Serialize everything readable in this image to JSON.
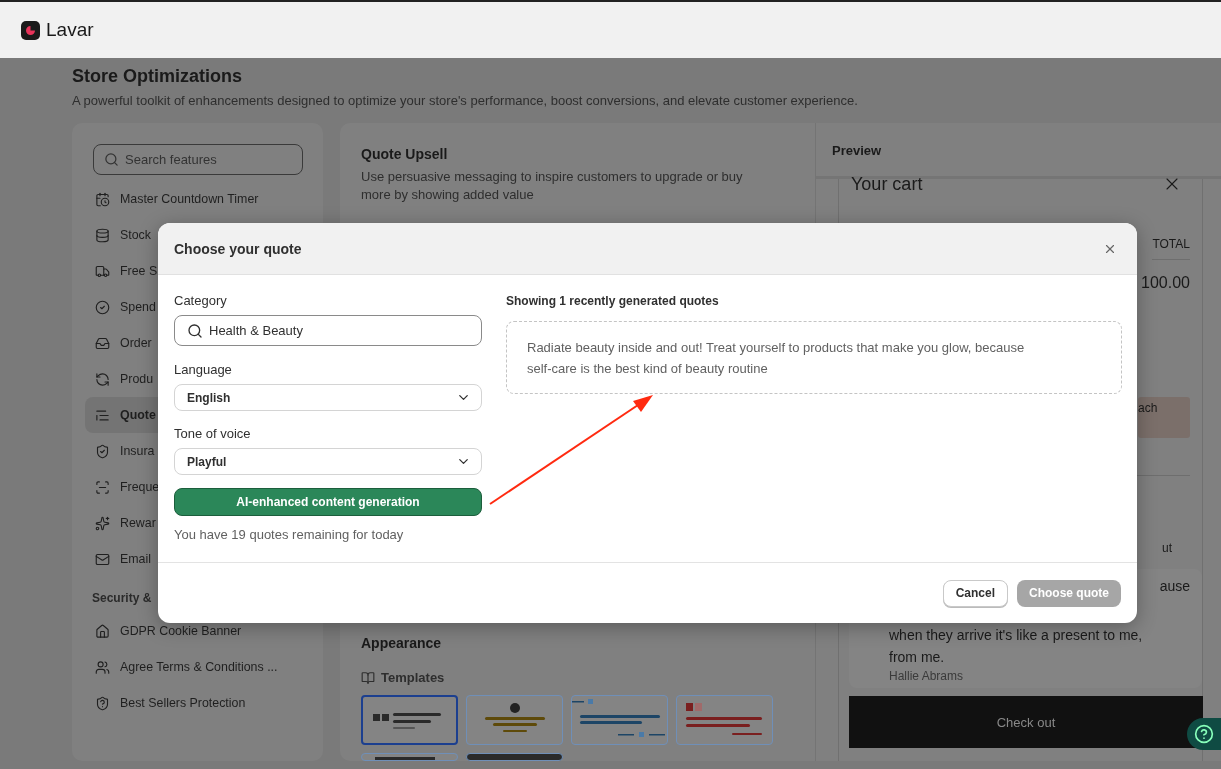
{
  "app": {
    "name": "Lavar"
  },
  "page": {
    "title": "Store Optimizations",
    "subtitle": "A powerful toolkit of enhancements designed to optimize your store's performance, boost conversions, and elevate customer experience."
  },
  "sidebar": {
    "search": {
      "placeholder": "Search features"
    },
    "groups": [
      {
        "items": [
          {
            "label": "Master Countdown Timer",
            "selected": false
          },
          {
            "label": "Stock",
            "selected": false
          },
          {
            "label": "Free S",
            "selected": false
          },
          {
            "label": "Spend",
            "selected": false
          },
          {
            "label": "Order",
            "selected": false
          },
          {
            "label": "Produ",
            "selected": false
          },
          {
            "label": "Quote",
            "selected": true
          },
          {
            "label": "Insura",
            "selected": false
          },
          {
            "label": "Freque",
            "selected": false
          },
          {
            "label": "Rewar",
            "selected": false
          },
          {
            "label": "Email",
            "selected": false
          }
        ]
      },
      {
        "heading": "Security &",
        "items": [
          {
            "label": "GDPR Cookie Banner",
            "selected": false
          },
          {
            "label": "Agree Terms & Conditions ...",
            "selected": false
          },
          {
            "label": "Best Sellers Protection",
            "selected": false
          }
        ]
      }
    ]
  },
  "feature": {
    "title": "Quote Upsell",
    "description": "Use persuasive messaging to inspire customers to upgrade or buy more by showing added value",
    "appearance": {
      "title": "Appearance",
      "templates_label": "Templates",
      "templates": [
        {
          "kind": "left-quote",
          "color": "#2a2a2a",
          "selected": true
        },
        {
          "kind": "center-badge",
          "color": "#5e4a0a",
          "selected": false
        },
        {
          "kind": "split-quote",
          "color": "#1d4566",
          "selected": false
        },
        {
          "kind": "bold-quote",
          "color": "#7a1f1f",
          "selected": false
        },
        {
          "kind": "plain",
          "color": "#2a2a2a",
          "selected": false
        },
        {
          "kind": "dark",
          "color": "#2a2a2a",
          "selected": false
        }
      ]
    }
  },
  "preview": {
    "title": "Preview",
    "cart_title": "Your cart",
    "column_header": "TOTAL",
    "price": "100.00",
    "promo_text": "ach",
    "line_text": "ut",
    "review": {
      "lines": [
        "ause",
        "when they arrive it's like a present to me,",
        "from me."
      ],
      "author": "Hallie Abrams"
    },
    "checkout_button": "Check out"
  },
  "modal": {
    "title": "Choose your quote",
    "category": {
      "label": "Category",
      "value": "Health & Beauty"
    },
    "language": {
      "label": "Language",
      "value": "English"
    },
    "tone": {
      "label": "Tone of voice",
      "value": "Playful"
    },
    "generate_button": "AI-enhanced content generation",
    "remaining": "You have 19 quotes remaining for today",
    "results_heading": "Showing 1 recently generated quotes",
    "quotes": [
      {
        "text": "Radiate beauty inside and out! Treat yourself to products that make you glow, because self-care is the best kind of beauty routine"
      }
    ],
    "cancel_button": "Cancel",
    "choose_button": {
      "label": "Choose quote",
      "disabled": true
    }
  }
}
